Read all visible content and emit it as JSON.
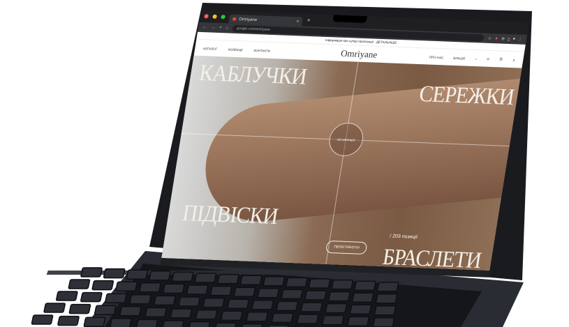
{
  "browser": {
    "tab_title": "Omriyane",
    "url": "google.com/omriyane"
  },
  "site": {
    "promo": "Інформація про супер пропозиції · ДЕТАЛЬНІШЕ",
    "nav_left": [
      "КАТАЛОГ",
      "КОЛЕКЦІЇ",
      "КОНТАКТИ"
    ],
    "logo": "Omriyane",
    "nav_right": [
      "ПРО НАС",
      "БІЛЬШЕ"
    ],
    "cart_count": "0"
  },
  "hero": {
    "categories": [
      "КАБЛУЧКИ",
      "СЕРЕЖКИ",
      "ПІДВІСКИ",
      "БРАСЛЕТИ"
    ],
    "center_label": "всі категорії",
    "count": "/ 203 позиції",
    "button": "ПЕРЕГЛЯНУТИ"
  }
}
